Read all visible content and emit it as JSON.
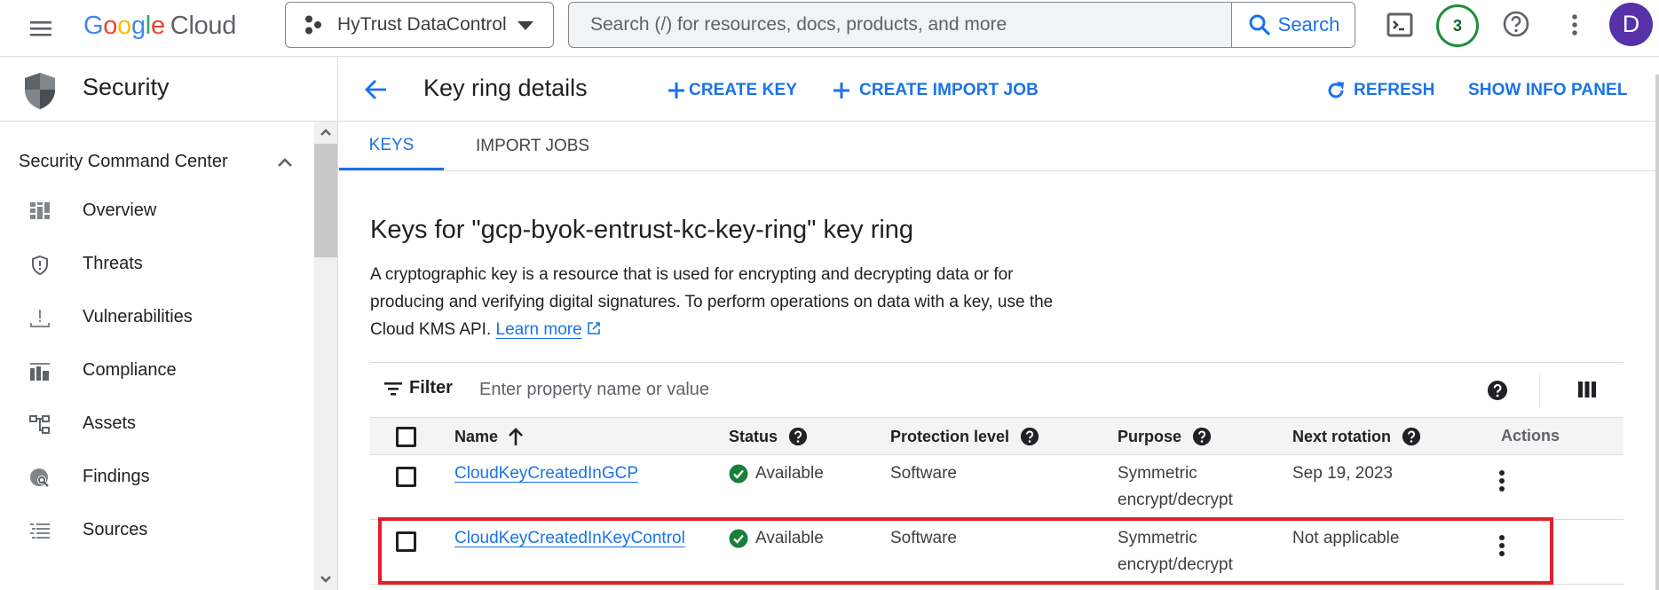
{
  "topbar": {
    "logo_letters": [
      "G",
      "o",
      "o",
      "g",
      "l",
      "e"
    ],
    "logo_product": "Cloud",
    "project_name": "HyTrust DataControl",
    "search_placeholder": "Search (/) for resources, docs, products, and more",
    "search_value": "",
    "search_button_label": "Search",
    "notification_count": "3",
    "avatar_initial": "D",
    "colors": {
      "accent": "#1a73e8",
      "avatar_bg": "#5631a8",
      "notif_ring": "#1e8e3e"
    }
  },
  "sidebar": {
    "product_title": "Security",
    "section_label": "Security Command Center",
    "section_expanded": true,
    "items": [
      {
        "label": "Overview",
        "icon": "dashboard-icon"
      },
      {
        "label": "Threats",
        "icon": "shield-alert-icon"
      },
      {
        "label": "Vulnerabilities",
        "icon": "vulnerability-icon"
      },
      {
        "label": "Compliance",
        "icon": "compliance-chart-icon"
      },
      {
        "label": "Assets",
        "icon": "assets-tree-icon"
      },
      {
        "label": "Findings",
        "icon": "findings-search-icon"
      },
      {
        "label": "Sources",
        "icon": "sources-list-icon"
      }
    ]
  },
  "page_header": {
    "title": "Key ring details",
    "actions": {
      "create_key": "CREATE KEY",
      "create_import_job": "CREATE IMPORT JOB",
      "refresh": "REFRESH",
      "show_info_panel": "SHOW INFO PANEL"
    }
  },
  "tabs": [
    {
      "label": "KEYS",
      "active": true
    },
    {
      "label": "IMPORT JOBS",
      "active": false
    }
  ],
  "content": {
    "section_title": "Keys for \"gcp-byok-entrust-kc-key-ring\" key ring",
    "description": "A cryptographic key is a resource that is used for encrypting and decrypting data or for producing and verifying digital signatures. To perform operations on data with a key, use the Cloud KMS API.",
    "learn_more_label": "Learn more"
  },
  "filter": {
    "label": "Filter",
    "placeholder": "Enter property name or value",
    "value": ""
  },
  "table": {
    "columns": {
      "name": "Name",
      "status": "Status",
      "protection_level": "Protection level",
      "purpose": "Purpose",
      "next_rotation": "Next rotation",
      "actions": "Actions"
    },
    "sort": {
      "column": "name",
      "direction": "ascending"
    },
    "rows": [
      {
        "name": "CloudKeyCreatedInGCP",
        "status": "Available",
        "protection_level": "Software",
        "purpose_line1": "Symmetric",
        "purpose_line2": "encrypt/decrypt",
        "next_rotation": "Sep 19, 2023",
        "highlighted": false
      },
      {
        "name": "CloudKeyCreatedInKeyControl",
        "status": "Available",
        "protection_level": "Software",
        "purpose_line1": "Symmetric",
        "purpose_line2": "encrypt/decrypt",
        "next_rotation": "Not applicable",
        "highlighted": true
      }
    ],
    "status_color": "#188038",
    "highlight_color": "#e41e26"
  }
}
